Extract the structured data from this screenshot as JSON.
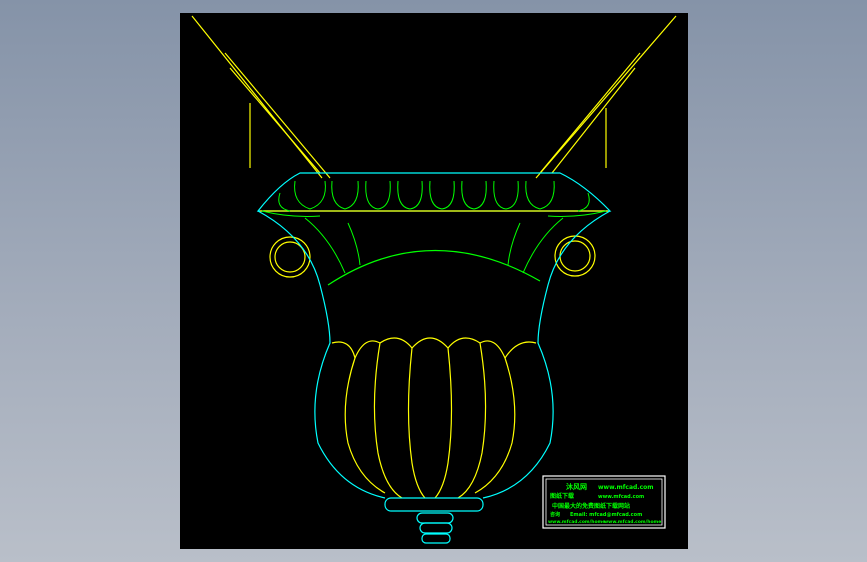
{
  "colors": {
    "background": "#000000",
    "outline": "#00ffff",
    "accent_line": "#ffff00",
    "detail_line": "#00ff00",
    "stamp_text": "#00ff00",
    "stamp_border": "#ffffff"
  },
  "stamp": {
    "line1_left": "沐风网",
    "line1_right": "www.mfcad.com",
    "line2_left": "图纸下载",
    "line2_right": "www.mfcad.com",
    "line3": "中国最大的免费图纸下载网站",
    "line4_label": "咨询",
    "line4_value": "Email: mfcad@mfcad.com",
    "line5_left": "www.mfcad.com/home",
    "line5_right": "www.mfcad.com/home"
  }
}
